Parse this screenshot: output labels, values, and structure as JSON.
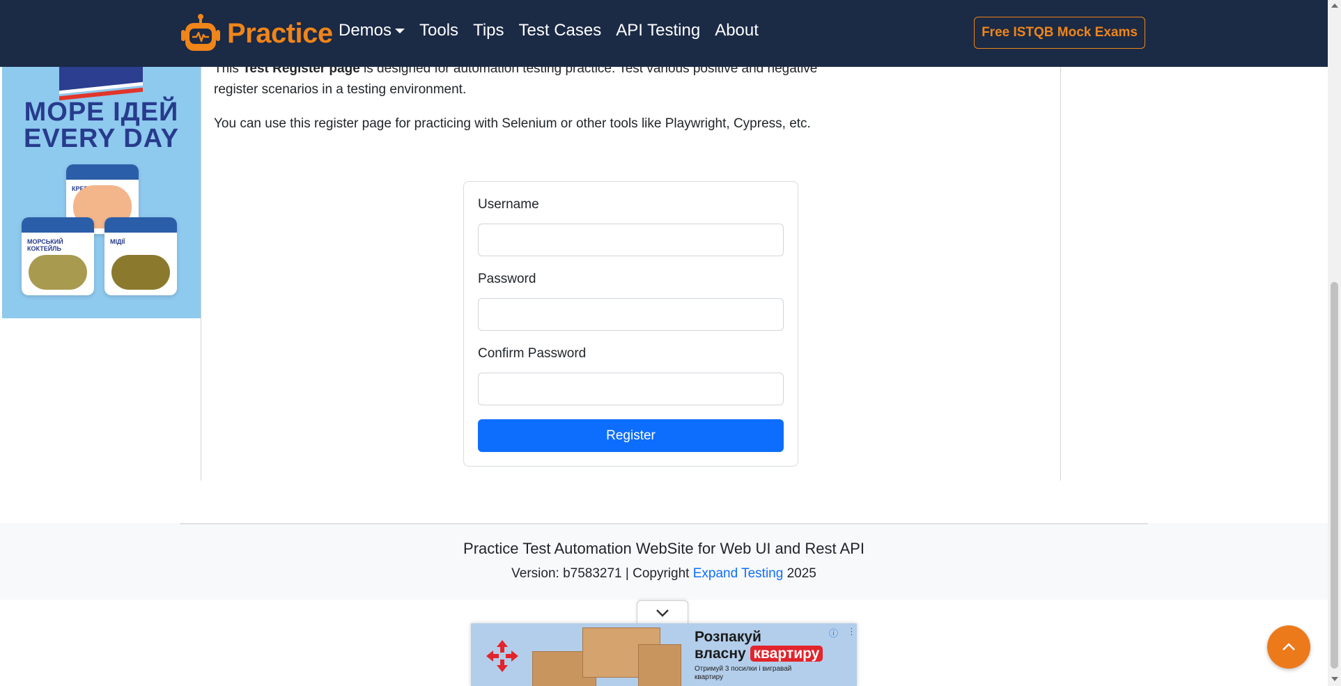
{
  "navbar": {
    "brand": "Practice",
    "links": [
      "Demos",
      "Tools",
      "Tips",
      "Test Cases",
      "API Testing",
      "About"
    ],
    "cta_label": "Free ISTQB Mock Exams",
    "brand_color": "#f08519",
    "background": "#1b2a45"
  },
  "left_ad": {
    "headline_line1": "МОРЕ ІДЕЙ",
    "headline_line2": "EVERY DAY",
    "pack_labels": [
      "КРЕВЕТКИ",
      "МОРСЬКИЙ КОКТЕЙЛЬ",
      "МІДІЇ"
    ]
  },
  "intro": {
    "p1_prefix": "This ",
    "p1_bold": "Test Register page",
    "p1_suffix": " is designed for automation testing practice. Test various positive and negative register scenarios in a testing environment.",
    "p2": "You can use this register page for practicing with Selenium or other tools like Playwright, Cypress, etc."
  },
  "form": {
    "username_label": "Username",
    "username_value": "",
    "password_label": "Password",
    "password_value": "",
    "confirm_label": "Confirm Password",
    "confirm_value": "",
    "submit_label": "Register",
    "submit_color": "#0d6efd"
  },
  "footer": {
    "title": "Practice Test Automation WebSite for Web UI and Rest API",
    "version_prefix": "Version: b7583271 | Copyright ",
    "link_text": "Expand Testing",
    "year": " 2025"
  },
  "bottom_ad": {
    "title_line1": "Розпакуй",
    "title_line2_prefix": "власну ",
    "title_highlight": "квартиру",
    "subtitle": "Отримуй 3 посилки і вигравай квартиру",
    "adchoices_icon": "info-icon",
    "more_icon": "vertical-dots-icon"
  },
  "icons": {
    "brand_logo": "robot-icon",
    "collapse": "chevron-down-icon",
    "scroll_top": "chevron-up-icon"
  }
}
